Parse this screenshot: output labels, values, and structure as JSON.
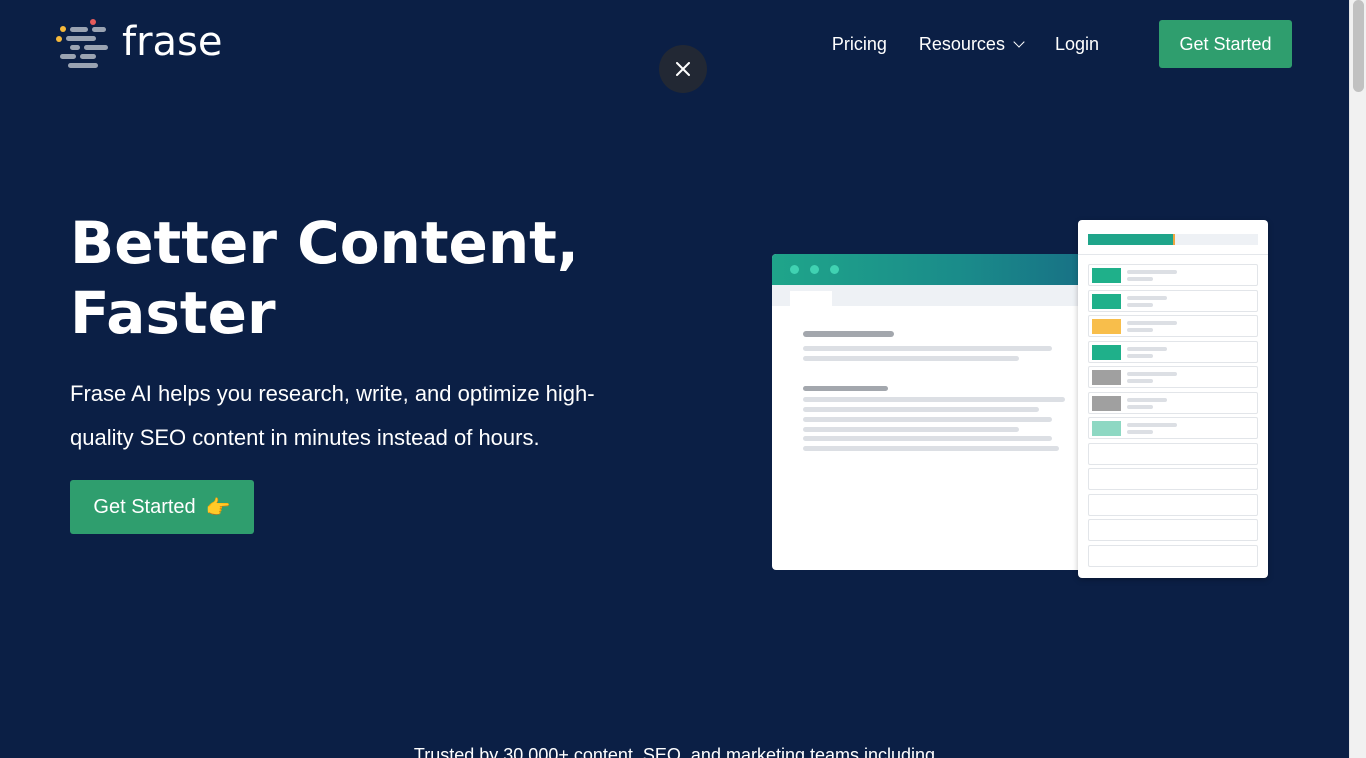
{
  "brand": {
    "name": "frase",
    "logo_colors": [
      "#f6b93b",
      "#e55a5a",
      "#9aa3b2"
    ]
  },
  "nav": {
    "items": [
      {
        "label": "Pricing"
      },
      {
        "label": "Resources"
      },
      {
        "label": "Login"
      }
    ],
    "cta_label": "Get Started"
  },
  "overlay": {
    "close_icon": "close-icon"
  },
  "hero": {
    "title_line1": "Better Content,",
    "title_line2": "Faster",
    "subtitle": "Frase AI helps you research, write, and optimize high-quality SEO content in minutes instead of hours.",
    "cta_label": "Get Started",
    "cta_icon": "👉"
  },
  "illustration": {
    "panel_score_fraction": 0.5,
    "row_colors": [
      "#1fb08a",
      "#1fb08a",
      "#f8be4b",
      "#1fb08a",
      "#a0a0a0",
      "#a0a0a0",
      "#8ed8c3"
    ]
  },
  "trusted": {
    "text": "Trusted by 30,000+ content, SEO, and marketing teams including"
  },
  "colors": {
    "background": "#0b1f45",
    "accent": "#2f9e6e"
  }
}
